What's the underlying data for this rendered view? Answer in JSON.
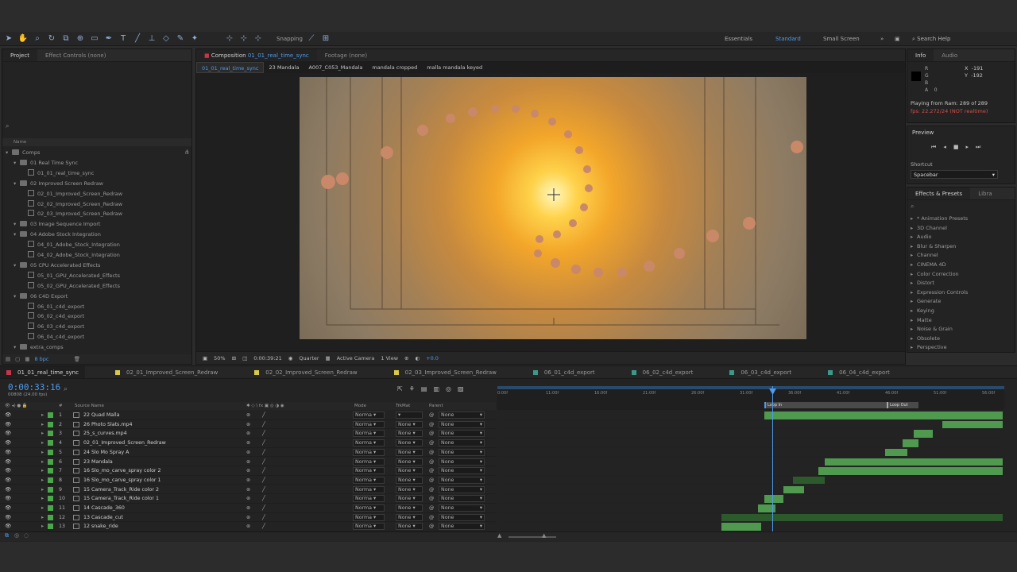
{
  "toolbar": {
    "snapping": "Snapping",
    "workspaces": [
      "Essentials",
      "Standard",
      "Small Screen"
    ],
    "active_workspace": "Standard",
    "search_help": "Search Help"
  },
  "project_panel": {
    "tabs": [
      "Project",
      "Effect Controls (none)"
    ],
    "col_name": "Name",
    "bpc": "8 bpc",
    "tree": [
      {
        "label": "Comps",
        "type": "folder",
        "indent": 0
      },
      {
        "label": "01 Real Time Sync",
        "type": "folder",
        "indent": 1
      },
      {
        "label": "01_01_real_time_sync",
        "type": "comp",
        "indent": 2
      },
      {
        "label": "02 Improved Screen Redraw",
        "type": "folder",
        "indent": 1
      },
      {
        "label": "02_01_Improved_Screen_Redraw",
        "type": "comp",
        "indent": 2
      },
      {
        "label": "02_02_Improved_Screen_Redraw",
        "type": "comp",
        "indent": 2
      },
      {
        "label": "02_03_Improved_Screen_Redraw",
        "type": "comp",
        "indent": 2
      },
      {
        "label": "03 Image Sequence Import",
        "type": "folder",
        "indent": 1
      },
      {
        "label": "04 Adobe Stock Integration",
        "type": "folder",
        "indent": 1
      },
      {
        "label": "04_01_Adobe_Stock_Integration",
        "type": "comp",
        "indent": 2
      },
      {
        "label": "04_02_Adobe_Stock_Integration",
        "type": "comp",
        "indent": 2
      },
      {
        "label": "05 CPU Accelerated Effects",
        "type": "folder",
        "indent": 1
      },
      {
        "label": "05_01_GPU_Accelerated_Effects",
        "type": "comp",
        "indent": 2
      },
      {
        "label": "05_02_GPU_Accelerated_Effects",
        "type": "comp",
        "indent": 2
      },
      {
        "label": "06 C4D Export",
        "type": "folder",
        "indent": 1
      },
      {
        "label": "06_01_c4d_export",
        "type": "comp",
        "indent": 2
      },
      {
        "label": "06_02_c4d_export",
        "type": "comp",
        "indent": 2
      },
      {
        "label": "06_03_c4d_export",
        "type": "comp",
        "indent": 2
      },
      {
        "label": "06_04_c4d_export",
        "type": "comp",
        "indent": 2
      },
      {
        "label": "extra_comps",
        "type": "folder",
        "indent": 1
      }
    ]
  },
  "viewer": {
    "tabs": [
      "Composition 01_01_real_time_sync",
      "Footage (none)"
    ],
    "comp_tab_prefix": "Composition",
    "comp_tab_name": "01_01_real_time_sync",
    "footage_tab": "Footage (none)",
    "breadcrumbs": [
      "01_01_real_time_sync",
      "23 Mandala",
      "A007_C053_Mandala",
      "mandala cropped",
      "malla mandala keyed"
    ],
    "zoom": "50%",
    "timecode": "0:00:39:21",
    "resolution": "Quarter",
    "camera": "Active Camera",
    "views": "1 View",
    "exposure": "+0.0"
  },
  "info_panel": {
    "tabs": [
      "Info",
      "Audio"
    ],
    "r": "R",
    "g": "G",
    "b": "B",
    "a": "A",
    "a_val": "0",
    "x_label": "X",
    "x_val": "-191",
    "y_label": "Y",
    "y_val": "-192",
    "playing": "Playing from Ram: 289 of 289",
    "fps": "fps: 22.272/24 (NOT realtime)"
  },
  "preview_panel": {
    "title": "Preview",
    "shortcut_label": "Shortcut",
    "shortcut_value": "Spacebar"
  },
  "effects_panel": {
    "tabs": [
      "Effects & Presets",
      "Libra"
    ],
    "items": [
      "* Animation Presets",
      "3D Channel",
      "Audio",
      "Blur & Sharpen",
      "Channel",
      "CINEMA 4D",
      "Color Correction",
      "Distort",
      "Expression Controls",
      "Generate",
      "Keying",
      "Matte",
      "Noise & Grain",
      "Obsolete",
      "Perspective"
    ]
  },
  "timeline": {
    "tabs": [
      {
        "label": "01_01_real_time_sync",
        "color": "#c8344a",
        "active": true
      },
      {
        "label": "02_01_Improved_Screen_Redraw",
        "color": "#d8c84a",
        "active": false
      },
      {
        "label": "02_02_Improved_Screen_Redraw",
        "color": "#d8c84a",
        "active": false
      },
      {
        "label": "02_03_Improved_Screen_Redraw",
        "color": "#d8c84a",
        "active": false
      },
      {
        "label": "06_01_c4d_export",
        "color": "#3a9a8a",
        "active": false
      },
      {
        "label": "06_02_c4d_export",
        "color": "#3a9a8a",
        "active": false
      },
      {
        "label": "06_03_c4d_export",
        "color": "#3a9a8a",
        "active": false
      },
      {
        "label": "06_04_c4d_export",
        "color": "#3a9a8a",
        "active": false
      }
    ],
    "current_time": "0:00:33:16",
    "frame_info": "00808 (24.00 fps)",
    "col_source": "Source Name",
    "col_mode": "Mode",
    "col_trkmat": "TrkMat",
    "col_parent": "Parent",
    "ruler": [
      "0:00f",
      "11:00f",
      "16:00f",
      "21:00f",
      "26:00f",
      "31:00f",
      "36:00f",
      "41:00f",
      "46:00f",
      "51:00f",
      "56:00f"
    ],
    "loop_in": "Loop In",
    "loop_out": "Loop Out",
    "layers": [
      {
        "num": "1",
        "name": "22 Quad Malla",
        "mode": "Norma",
        "trkmat": "",
        "parent": "None"
      },
      {
        "num": "2",
        "name": "26 Photo Slats.mp4",
        "mode": "Norma",
        "trkmat": "None",
        "parent": "None"
      },
      {
        "num": "3",
        "name": "25_s_curves.mp4",
        "mode": "Norma",
        "trkmat": "None",
        "parent": "None"
      },
      {
        "num": "4",
        "name": "02_01_Improved_Screen_Redraw",
        "mode": "Norma",
        "trkmat": "None",
        "parent": "None"
      },
      {
        "num": "5",
        "name": "24 Slo Mo Spray A",
        "mode": "Norma",
        "trkmat": "None",
        "parent": "None"
      },
      {
        "num": "6",
        "name": "23 Mandala",
        "mode": "Norma",
        "trkmat": "None",
        "parent": "None"
      },
      {
        "num": "7",
        "name": "16 Slo_mo_carve_spray color 2",
        "mode": "Norma",
        "trkmat": "None",
        "parent": "None"
      },
      {
        "num": "8",
        "name": "16 Slo_mo_carve_spray color 1",
        "mode": "Norma",
        "trkmat": "None",
        "parent": "None"
      },
      {
        "num": "9",
        "name": "15 Camera_Track_Ride color 2",
        "mode": "Norma",
        "trkmat": "None",
        "parent": "None"
      },
      {
        "num": "10",
        "name": "15 Camera_Track_Ride color 1",
        "mode": "Norma",
        "trkmat": "None",
        "parent": "None"
      },
      {
        "num": "11",
        "name": "14 Cascade_360",
        "mode": "Norma",
        "trkmat": "None",
        "parent": "None"
      },
      {
        "num": "12",
        "name": "13 Cascade_cut",
        "mode": "Norma",
        "trkmat": "None",
        "parent": "None"
      },
      {
        "num": "13",
        "name": "12 snake_ride",
        "mode": "Norma",
        "trkmat": "None",
        "parent": "None"
      }
    ]
  }
}
